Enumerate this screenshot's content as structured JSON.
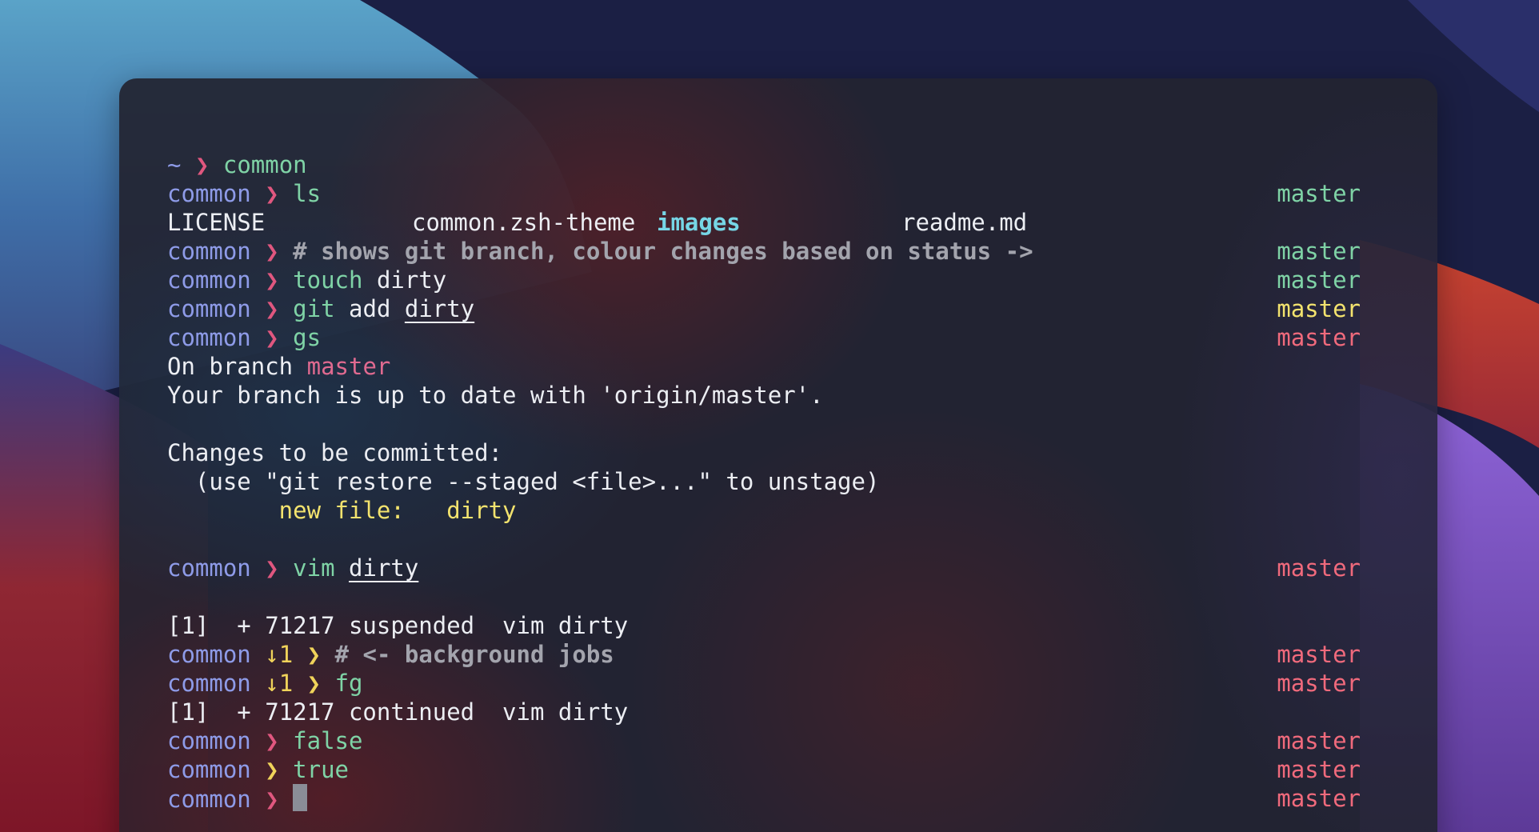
{
  "colors": {
    "dir": "#8e9be8",
    "prompt_arrow": "#e0577f",
    "prompt_arrow_alt": "#f0d35a",
    "command": "#7fd3a6",
    "branch_clean": "#7fd3a6",
    "branch_staged": "#f3e36e",
    "branch_dirty": "#f06a7c",
    "comment": "#a3a4ad",
    "text": "#eceef3"
  },
  "prompt": {
    "dir": "common",
    "home_dir": "~",
    "arrow": "❯",
    "branch": "master",
    "jobs": "↓1"
  },
  "terminal": {
    "line1_cmd": "common",
    "line2_cmd": "ls",
    "ls_files": [
      "LICENSE",
      "common.zsh-theme",
      "images",
      "readme.md"
    ],
    "line4_comment": "# shows git branch, colour changes based on status ->",
    "line5_cmd": "touch",
    "line5_arg": "dirty",
    "line6_cmd": "git",
    "line6_sub": "add",
    "line6_arg": "dirty",
    "line7_cmd": "gs",
    "status_branch_prefix": "On branch ",
    "status_branch_name": "master",
    "status_uptodate": "Your branch is up to date with 'origin/master'.",
    "status_changes_header": "Changes to be committed:",
    "status_hint": "  (use \"git restore --staged <file>...\" to unstage)",
    "status_newfile_label": "        new file:   ",
    "status_newfile_name": "dirty",
    "vim_cmd": "vim",
    "vim_arg": "dirty",
    "job_suspended": "[1]  + 71217 suspended  vim dirty",
    "jobs_comment": "# <- background jobs",
    "fg_cmd": "fg",
    "job_continued": "[1]  + 71217 continued  vim dirty",
    "false_cmd": "false",
    "true_cmd": "true"
  }
}
